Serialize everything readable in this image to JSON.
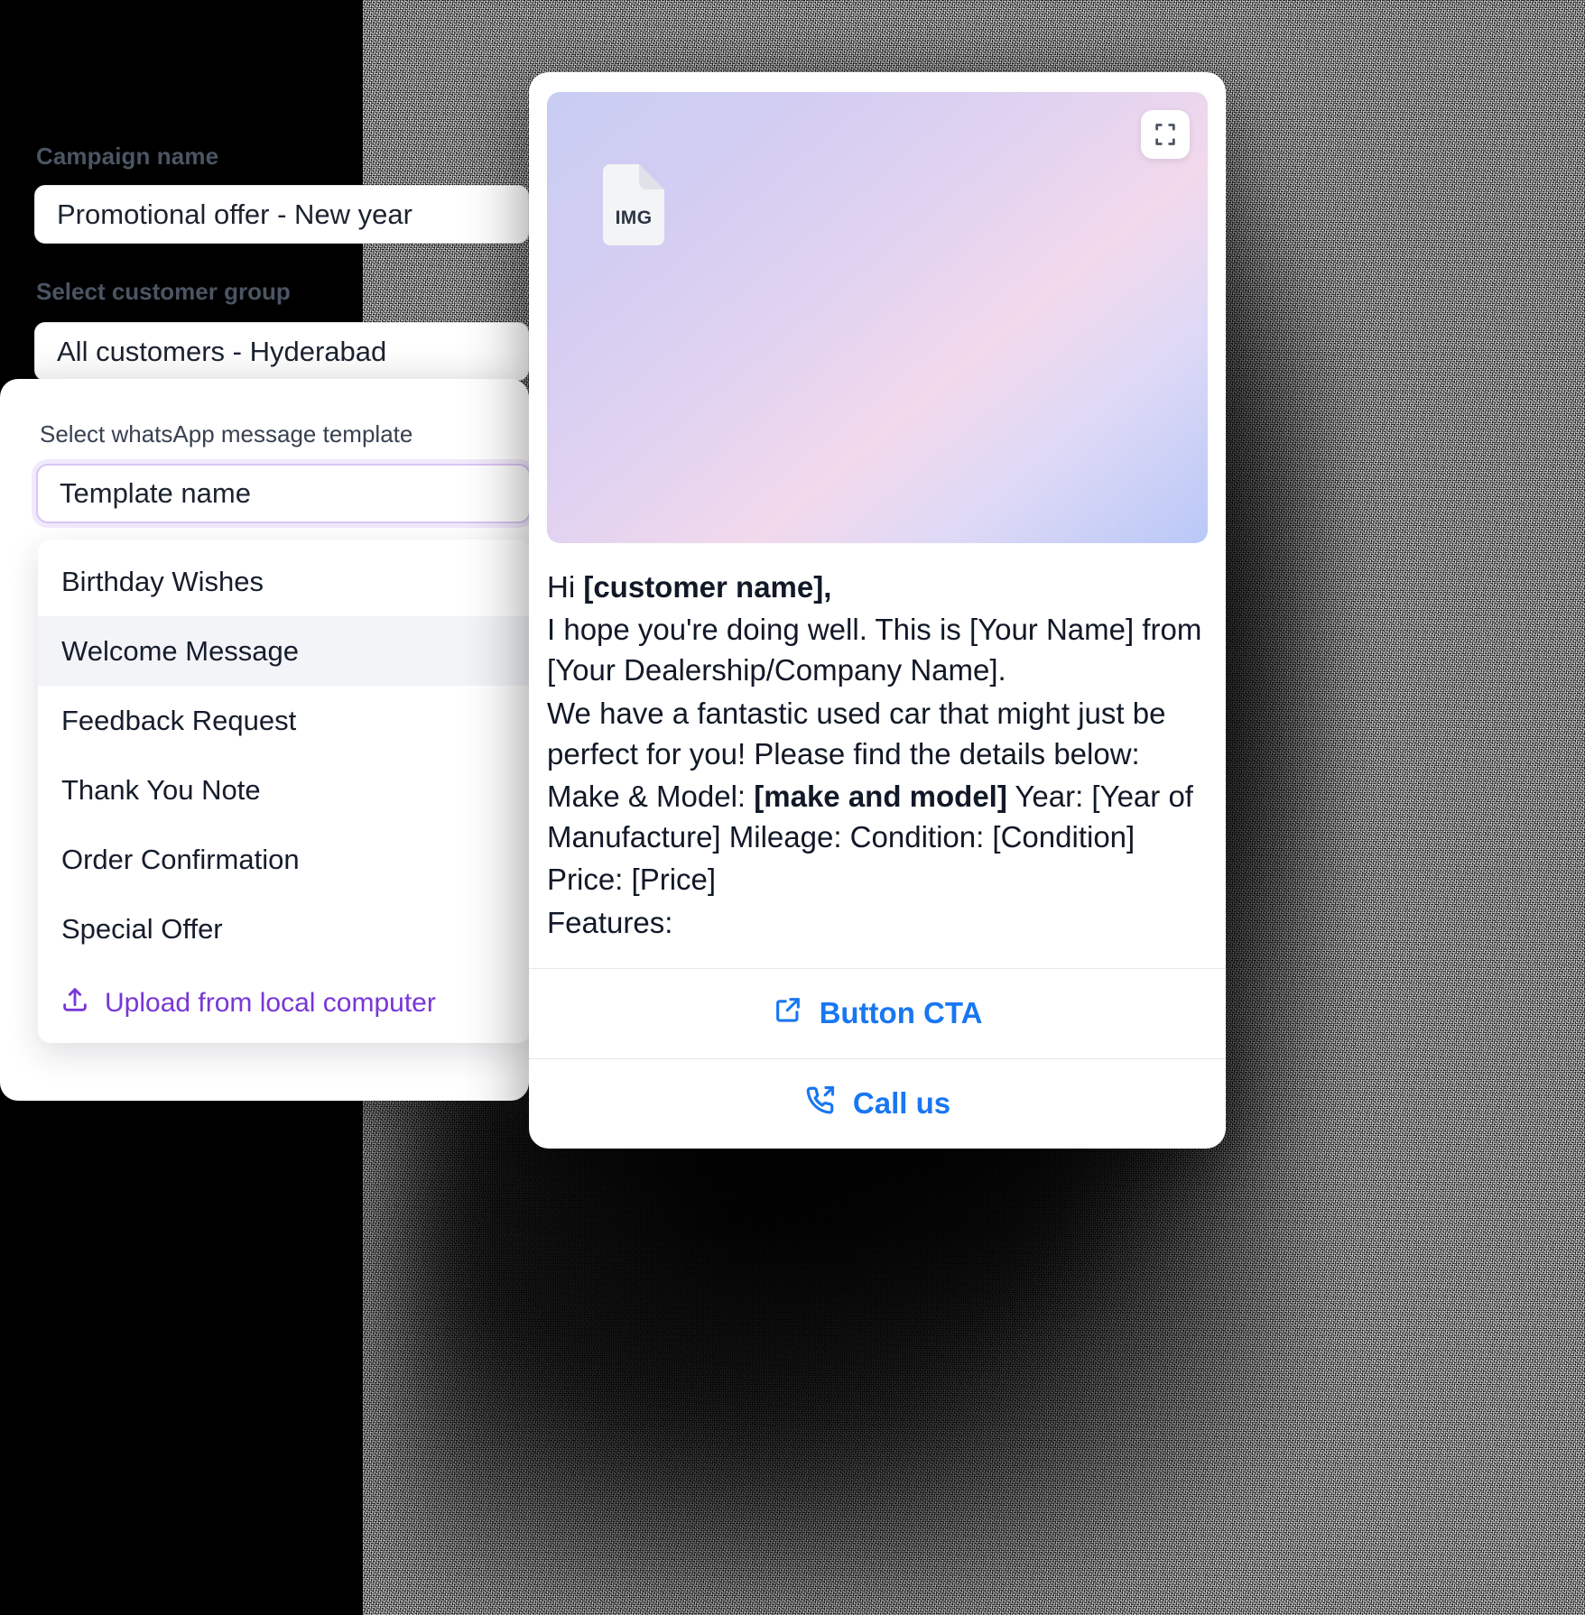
{
  "form": {
    "campaign_label": "Campaign name",
    "campaign_value": "Promotional offer - New year",
    "group_label": "Select customer group",
    "group_value": "All customers - Hyderabad",
    "template_label": "Select whatsApp message template",
    "template_value": "Template name",
    "accent_color": "#7736d6"
  },
  "dropdown": {
    "items": [
      {
        "label": "Birthday Wishes",
        "selected": false
      },
      {
        "label": "Welcome Message",
        "selected": true
      },
      {
        "label": "Feedback Request",
        "selected": false
      },
      {
        "label": "Thank You Note",
        "selected": false
      },
      {
        "label": "Order Confirmation",
        "selected": false
      },
      {
        "label": "Special Offer",
        "selected": false
      }
    ],
    "upload_label": "Upload from local computer",
    "upload_icon": "upload-icon"
  },
  "preview": {
    "media": {
      "file_badge": "IMG",
      "file_icon": "image-file-icon",
      "expand_icon": "expand-icon"
    },
    "message": {
      "greeting_prefix": "Hi ",
      "greeting_name": "[customer name],",
      "line1": "I hope you're doing well. This is [Your Name] from [Your Dealership/Company Name].",
      "line2": "We have a fantastic used car that might just be perfect for you! Please find the details below:",
      "line3_prefix": "Make & Model: ",
      "line3_bold": "[make and model]",
      "line3_suffix": " Year: [Year of Manufacture] Mileage: Condition: [Condition]",
      "line4": "Price: [Price]",
      "line5": "Features:"
    },
    "ctas": [
      {
        "label": "Button CTA",
        "icon": "external-link-icon",
        "color": "#1877f2"
      },
      {
        "label": "Call us",
        "icon": "phone-outgoing-icon",
        "color": "#1877f2"
      }
    ]
  }
}
